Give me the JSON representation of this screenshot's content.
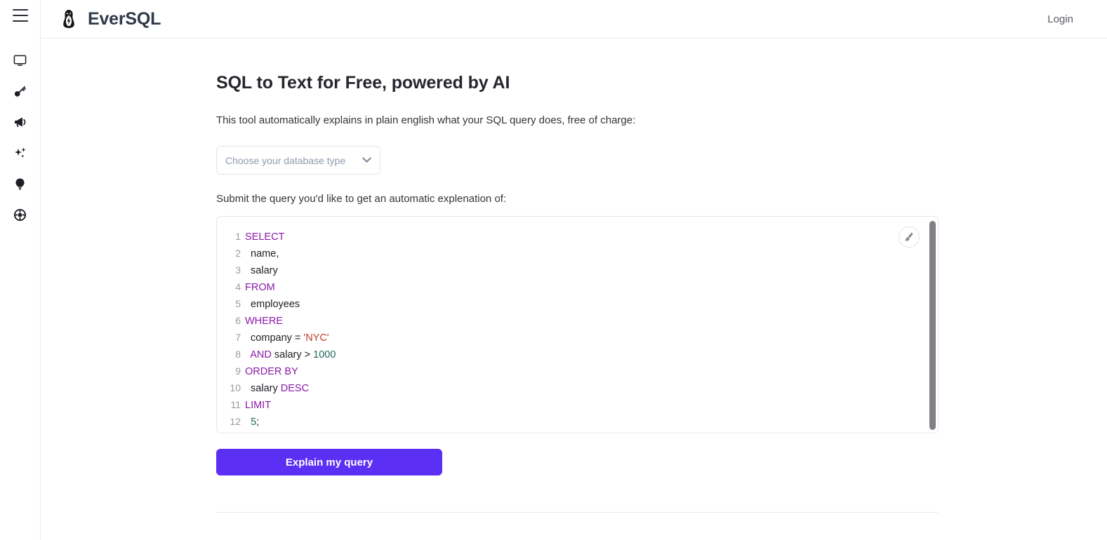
{
  "sidebar": {
    "menu_toggle": "hamburger-menu",
    "items": [
      {
        "name": "monitor-icon",
        "label": "Dashboard"
      },
      {
        "name": "key-icon",
        "label": "Access Keys"
      },
      {
        "name": "megaphone-icon",
        "label": "Announcements"
      },
      {
        "name": "sparkles-icon",
        "label": "AI Tools"
      },
      {
        "name": "lightbulb-icon",
        "label": "Insights"
      },
      {
        "name": "lifebuoy-icon",
        "label": "Support"
      }
    ]
  },
  "header": {
    "logo_icon": "penguin-logo-icon",
    "brand": "EverSQL",
    "login_label": "Login"
  },
  "main": {
    "title": "SQL to Text for Free, powered by AI",
    "lede": "This tool automatically explains in plain english what your SQL query does, free of charge:",
    "select": {
      "placeholder": "Choose your database type",
      "selected": "Choose your database type",
      "options": [
        "Choose your database type"
      ],
      "chevron_icon": "chevron-down-icon"
    },
    "sublede": "Submit the query you'd like to get an automatic explenation of:",
    "editor": {
      "beautify_icon": "paintbrush-icon",
      "lines": [
        {
          "n": "1",
          "tokens": [
            {
              "t": "SELECT",
              "c": "kw"
            }
          ]
        },
        {
          "n": "2",
          "tokens": [
            {
              "t": "  name,",
              "c": ""
            }
          ]
        },
        {
          "n": "3",
          "tokens": [
            {
              "t": "  salary",
              "c": ""
            }
          ]
        },
        {
          "n": "4",
          "tokens": [
            {
              "t": "FROM",
              "c": "kw"
            }
          ]
        },
        {
          "n": "5",
          "tokens": [
            {
              "t": "  employees",
              "c": ""
            }
          ]
        },
        {
          "n": "6",
          "tokens": [
            {
              "t": "WHERE",
              "c": "kw"
            }
          ]
        },
        {
          "n": "7",
          "tokens": [
            {
              "t": "  company = ",
              "c": ""
            },
            {
              "t": "'NYC'",
              "c": "str"
            }
          ]
        },
        {
          "n": "8",
          "tokens": [
            {
              "t": "  ",
              "c": ""
            },
            {
              "t": "AND",
              "c": "kw"
            },
            {
              "t": " salary > ",
              "c": ""
            },
            {
              "t": "1000",
              "c": "num"
            }
          ]
        },
        {
          "n": "9",
          "tokens": [
            {
              "t": "ORDER BY",
              "c": "kw"
            }
          ]
        },
        {
          "n": "10",
          "tokens": [
            {
              "t": "  salary ",
              "c": ""
            },
            {
              "t": "DESC",
              "c": "kw"
            }
          ]
        },
        {
          "n": "11",
          "tokens": [
            {
              "t": "LIMIT",
              "c": "kw"
            }
          ]
        },
        {
          "n": "12",
          "tokens": [
            {
              "t": "  ",
              "c": ""
            },
            {
              "t": "5",
              "c": "num"
            },
            {
              "t": ";",
              "c": ""
            }
          ]
        }
      ]
    },
    "submit_label": "Explain my query"
  },
  "colors": {
    "accent": "#5c2ff5",
    "keyword": "#8b19a8",
    "string": "#c0392b",
    "number": "#1d6a5a",
    "muted_text": "#8f9bad",
    "border": "#e7e7ec"
  }
}
